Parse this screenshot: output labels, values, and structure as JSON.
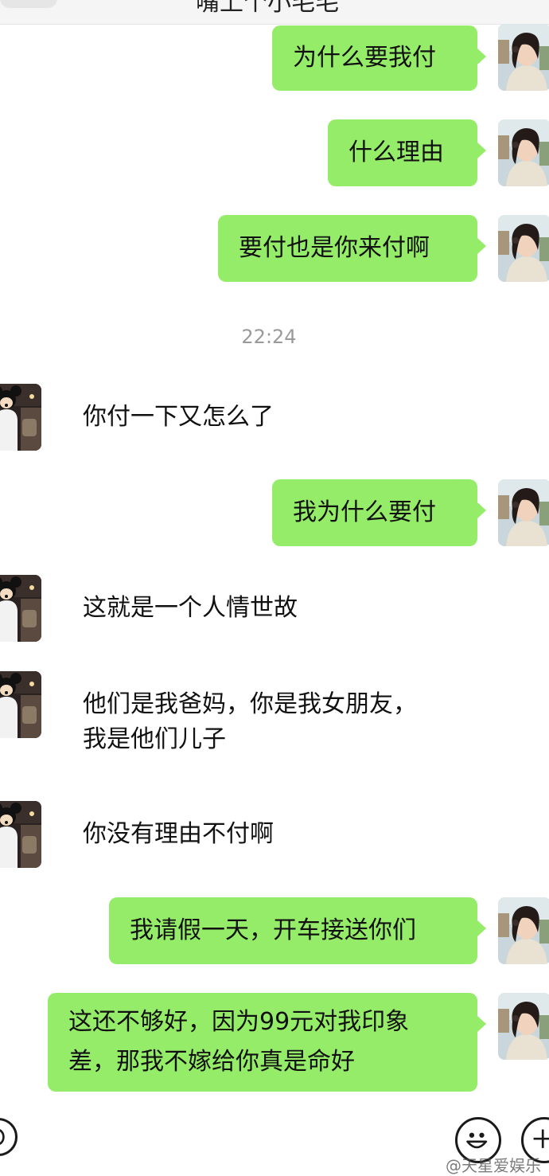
{
  "header": {
    "title": "嘴上个小毛毛"
  },
  "messages": [
    {
      "side": "right",
      "text": "为什么要我付"
    },
    {
      "side": "right",
      "text": "什么理由"
    },
    {
      "side": "right",
      "text": "要付也是你来付啊"
    },
    {
      "side": "left",
      "text": "你付一下又怎么了"
    },
    {
      "side": "right",
      "text": "我为什么要付"
    },
    {
      "side": "left",
      "text": "这就是一个人情世故"
    },
    {
      "side": "left",
      "lines": [
        "他们是我爸妈，你是我女朋友，",
        "我是他们儿子"
      ]
    },
    {
      "side": "left",
      "text": "你没有理由不付啊"
    },
    {
      "side": "right",
      "text": "我请假一天，开车接送你们"
    },
    {
      "side": "right",
      "lines": [
        "这还不够好，因为99元对我印象",
        "差，那我不嫁给你真是命好"
      ]
    }
  ],
  "timestamp": "22:24",
  "toolbar": {
    "voice_icon": "voice-icon",
    "emoji_icon": "emoji-icon",
    "plus_icon": "plus-icon"
  },
  "watermark": "@天星爱娱乐",
  "colors": {
    "bubble_green": "#95ec69",
    "background": "#ffffff",
    "timestamp_gray": "#9a9a9a"
  }
}
